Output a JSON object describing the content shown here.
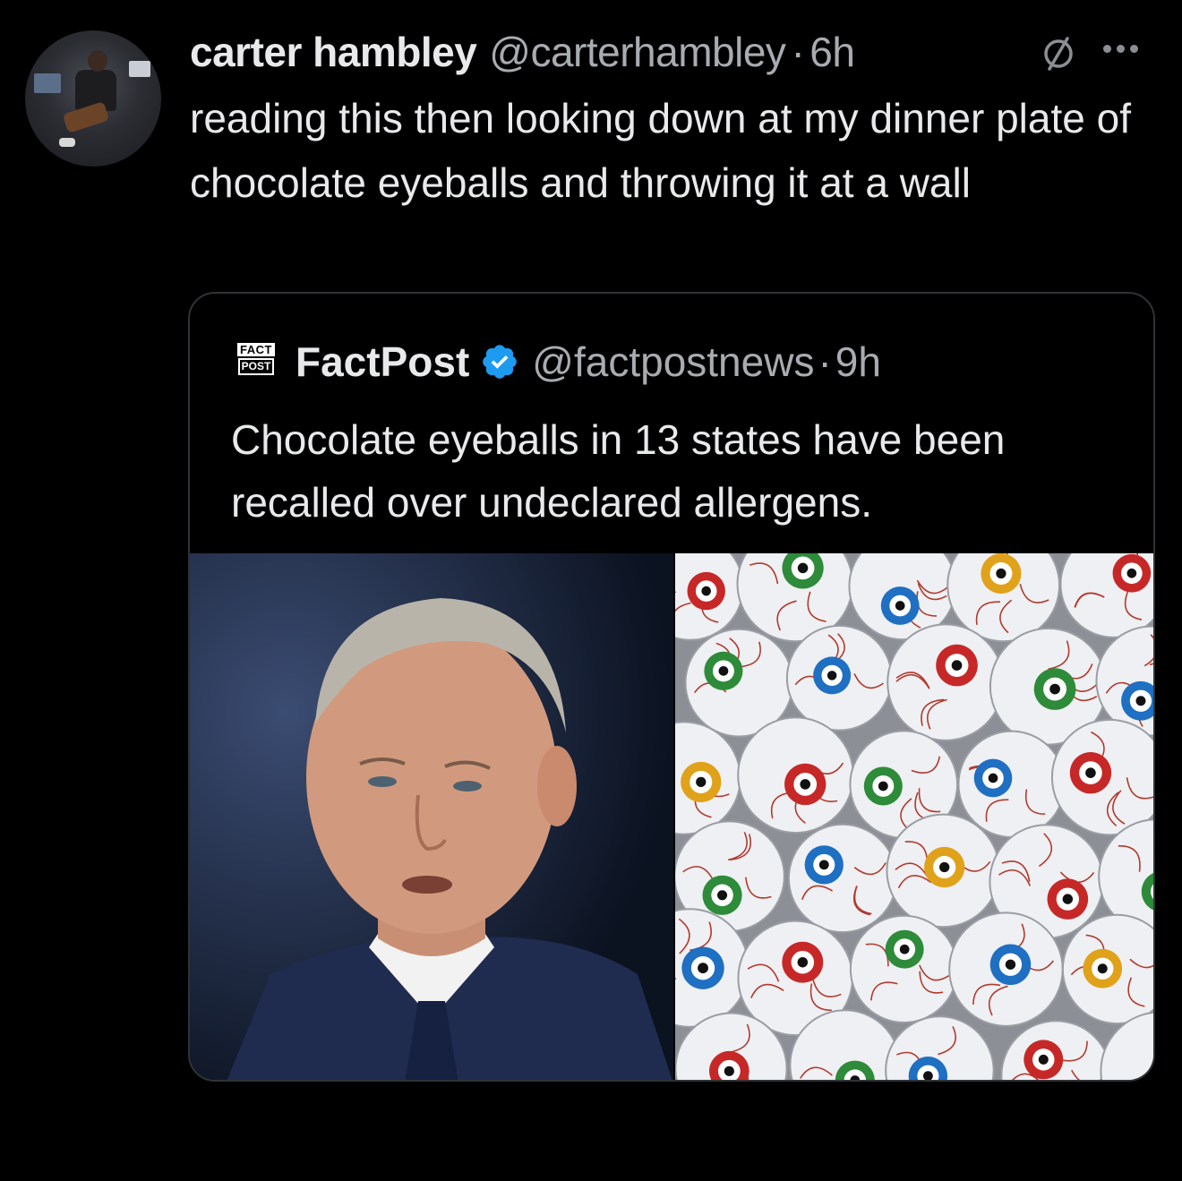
{
  "tweet": {
    "author_name": "carter hambley",
    "author_handle": "@carterhambley",
    "separator": "·",
    "time": "6h",
    "text": "reading this then looking down at my dinner plate of chocolate eyeballs and throwing it at a wall"
  },
  "quoted_tweet": {
    "logo_line1": "FACT",
    "logo_line2": "POST",
    "author_name": "FactPost",
    "author_handle": "@factpostnews",
    "separator": "·",
    "time": "9h",
    "text": "Chocolate eyeballs in 13 states have been recalled over undeclared allergens.",
    "verified_color": "#1d9bf0"
  },
  "icons": {
    "header_status": "null-set-icon",
    "more": "more-options-icon",
    "verified": "verified-badge-icon"
  },
  "colors": {
    "background": "#000000",
    "text_primary": "#e7e9ea",
    "text_secondary": "#a8acb1",
    "border": "#2f3336"
  }
}
